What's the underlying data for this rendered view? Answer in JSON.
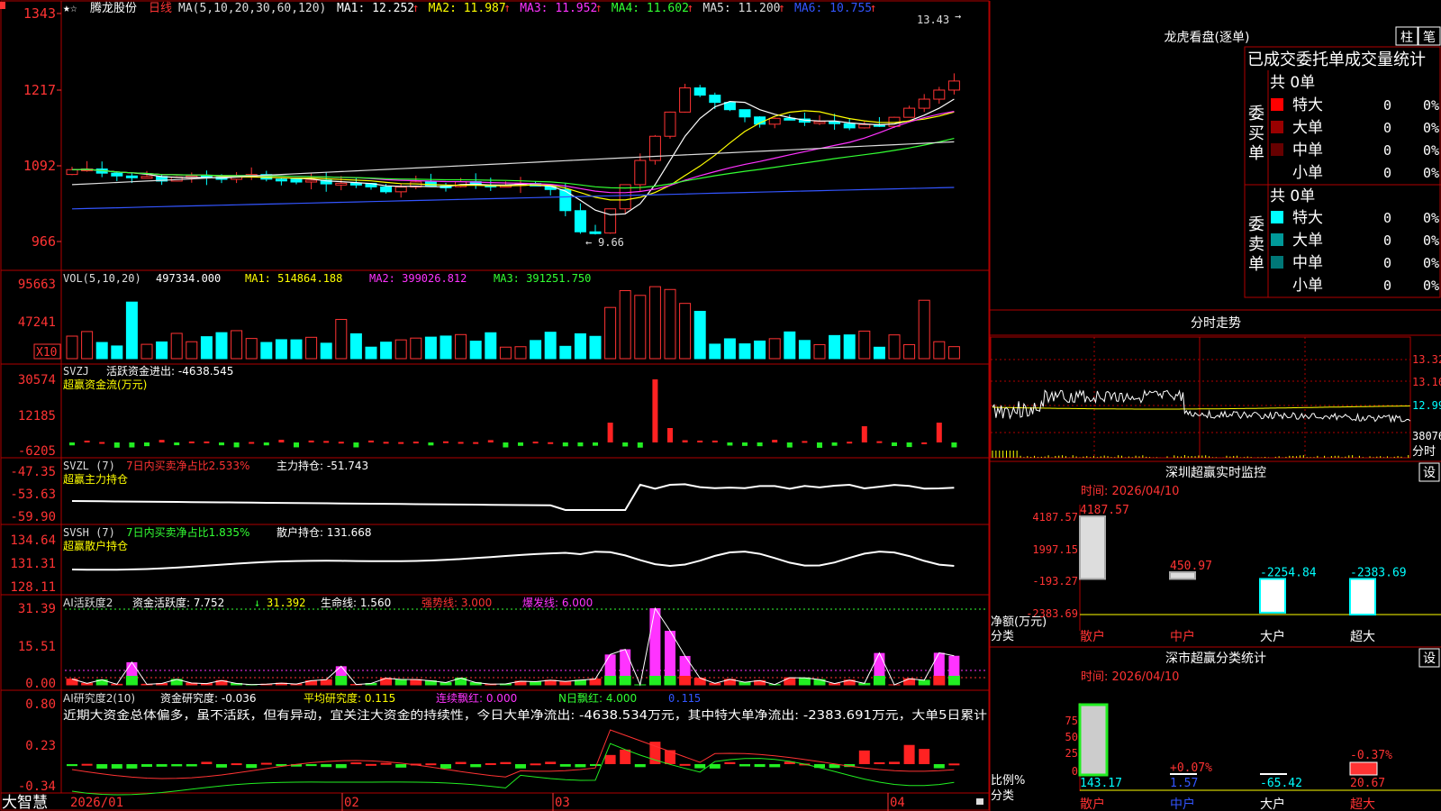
{
  "app": {
    "brand": "大智慧"
  },
  "header": {
    "stock_name": "腾龙股份",
    "period": "日线",
    "ma_params": "MA(5,10,20,30,60,120)",
    "ma_values": [
      {
        "label": "MA1: 12.252",
        "arrow": "↑",
        "color": "#ffffff"
      },
      {
        "label": "MA2: 11.987",
        "arrow": "↑",
        "color": "#ffff00"
      },
      {
        "label": "MA3: 11.952",
        "arrow": "↑",
        "color": "#ff33ff"
      },
      {
        "label": "MA4: 11.602",
        "arrow": "↑",
        "color": "#33ff33"
      },
      {
        "label": "MA5: 11.200",
        "arrow": "↑",
        "color": "#dddddd"
      },
      {
        "label": "MA6: 10.755",
        "arrow": "↑",
        "color": "#3355ff"
      }
    ],
    "high_label": "13.43",
    "low_label": "9.66"
  },
  "price_axis": [
    "1343",
    "1217",
    "1092",
    "966"
  ],
  "volume": {
    "title": "VOL(5,10,20)",
    "value": "497334.000",
    "ma1": "MA1: 514864.188",
    "ma2": "MA2: 399026.812",
    "ma3": "MA3: 391251.750",
    "axis": [
      "95663",
      "47241"
    ],
    "unit": "X10"
  },
  "svzj": {
    "title": "SVZJ",
    "line1": "活跃资金进出: -4638.545",
    "subtitle": "超赢资金流(万元)",
    "axis": [
      "30574",
      "12185",
      "-6205"
    ]
  },
  "svzl": {
    "title": "SVZL (7)",
    "ratio": "7日内买卖净占比2.533%",
    "value": "主力持仓: -51.743",
    "subtitle": "超赢主力持仓",
    "axis": [
      "-47.35",
      "-53.63",
      "-59.90"
    ]
  },
  "svsh": {
    "title": "SVSH (7)",
    "ratio": "7日内买卖净占比1.835%",
    "value": "散户持仓: 131.668",
    "subtitle": "超赢散户持仓",
    "axis": [
      "134.64",
      "131.31",
      "128.11"
    ]
  },
  "ai_active": {
    "title": "AI活跃度2",
    "v1": "资金活跃度: 7.752",
    "v2": "31.392",
    "v3": "生命线: 1.560",
    "v4": "强势线: 3.000",
    "v5": "爆发线: 6.000",
    "axis": [
      "31.39",
      "15.51",
      "0.00"
    ]
  },
  "ai_research": {
    "title": "AI研究度2(10)",
    "v1": "资金研究度: -0.036",
    "v2": "平均研究度: 0.115",
    "v3": "连续飘红: 0.000",
    "v4": "N日飘红: 4.000",
    "v5": "0.115",
    "comment": "近期大资金总体偏多，虽不活跃，但有异动，宜关注大资金的持续性，今日大单净流出: -4638.534万元，其中特大单净流出: -2383.691万元，大单5日累计",
    "axis": [
      "0.80",
      "0.23",
      "-0.34"
    ]
  },
  "date_axis": [
    "2026/01",
    "02",
    "03",
    "04"
  ],
  "dragon": {
    "title": "龙虎看盘(逐单)",
    "btn1": "柱",
    "btn2": "笔",
    "subtitle": "已成交委托单成交量统计",
    "buy_label": "委买单",
    "sell_label": "委卖单",
    "buy_total": "共 0单",
    "sell_total": "共 0单",
    "buy_rows": [
      {
        "name": "特大",
        "count": "0",
        "pct": "0%",
        "color": "#ff0000"
      },
      {
        "name": "大单",
        "count": "0",
        "pct": "0%",
        "color": "#990000"
      },
      {
        "name": "中单",
        "count": "0",
        "pct": "0%",
        "color": "#660000"
      },
      {
        "name": "小单",
        "count": "0",
        "pct": "0%",
        "color": "#000000"
      }
    ],
    "sell_rows": [
      {
        "name": "特大",
        "count": "0",
        "pct": "0%",
        "color": "#00ffff"
      },
      {
        "name": "大单",
        "count": "0",
        "pct": "0%",
        "color": "#009999"
      },
      {
        "name": "中单",
        "count": "0",
        "pct": "0%",
        "color": "#007777"
      },
      {
        "name": "小单",
        "count": "0",
        "pct": "0%",
        "color": "#000000"
      }
    ]
  },
  "intraday": {
    "title": "分时走势",
    "axis": [
      "13.32",
      "13.16",
      "12.99",
      "38076"
    ],
    "tail": "分时"
  },
  "sz_monitor": {
    "title": "深圳超赢实时监控",
    "btn": "设",
    "time": "时间: 2026/04/10",
    "axis": [
      "4187.57",
      "1997.15",
      "-193.27",
      "-2383.69"
    ],
    "ylabel1": "净额(万元)",
    "ylabel2": "分类",
    "bars": [
      {
        "name": "散户",
        "value": 4187.57,
        "label": "4187.57",
        "color": "#cccccc"
      },
      {
        "name": "中户",
        "value": 450.97,
        "label": "450.97",
        "color": "#cccccc"
      },
      {
        "name": "大户",
        "value": -2254.84,
        "label": "-2254.84",
        "color": "#ffffff"
      },
      {
        "name": "超大",
        "value": -2383.69,
        "label": "-2383.69",
        "color": "#ffffff"
      }
    ],
    "ylim": [
      -2383.69,
      4187.57
    ]
  },
  "sz_class": {
    "title": "深市超赢分类统计",
    "btn": "设",
    "time": "时间: 2026/04/10",
    "axis": [
      "75",
      "50",
      "25",
      "0"
    ],
    "ylabel1": "比例%",
    "ylabel2": "分类",
    "bars": [
      {
        "name": "散户",
        "value": 143.17,
        "label": "143.17",
        "pct": ""
      },
      {
        "name": "中户",
        "value": 1.57,
        "label": "1.57",
        "pct": "+0.07%"
      },
      {
        "name": "大户",
        "value": -65.42,
        "label": "-65.42",
        "pct": ""
      },
      {
        "name": "超大",
        "value": 20.67,
        "label": "20.67",
        "pct": "-0.37%"
      }
    ]
  },
  "chart_data": {
    "type": "bar",
    "categories": [
      "散户",
      "中户",
      "大户",
      "超大"
    ],
    "values": [
      4187.57,
      450.97,
      -2254.84,
      -2383.69
    ],
    "title": "深圳超赢实时监控",
    "ylabel": "净额(万元)",
    "ylim": [
      -2383.69,
      4187.57
    ]
  }
}
